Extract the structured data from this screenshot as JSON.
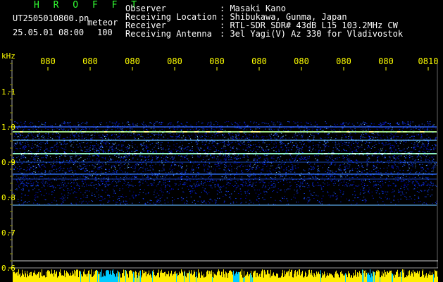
{
  "header": {
    "app": "H R O F F T",
    "file": "UT2505010800.pn",
    "mode": "meteor",
    "datetime": "25.05.01 08:00",
    "count": "100",
    "labels": [
      "Observer",
      "Receiving Location",
      "Receiver",
      "Receiving Antenna"
    ],
    "values": [
      ": Masaki Kano",
      ": Shibukawa, Gunma, Japan",
      ": RTL-SDR SDR# 43dB L15 103.2MHz CW",
      ": 3el Yagi(V) Az 330 for Vladivostok"
    ]
  },
  "axis": {
    "unit": "kHz",
    "y_ticks": [
      "1.1",
      "1.0",
      "0.9",
      "0.8",
      "0.7",
      "0.6"
    ],
    "x_ticks": [
      "080",
      "080",
      "080",
      "080",
      "080",
      "080",
      "080",
      "080",
      "080",
      "0810"
    ]
  },
  "colors": {
    "background": "#000000",
    "axis": "#ffff00",
    "title": "#33ff33",
    "signal_low": "#0000aa",
    "signal_high": "#ffff66",
    "baseline": "#00ccff"
  }
}
